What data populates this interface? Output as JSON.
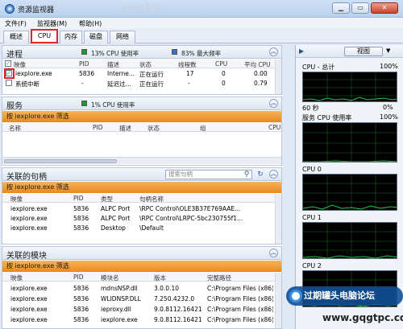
{
  "window": {
    "title": "资源监视器",
    "watermark_brand": "yesky"
  },
  "menu": {
    "file": "文件(F)",
    "monitor": "监视器(M)",
    "help": "帮助(H)"
  },
  "tabs": [
    "概述",
    "CPU",
    "内存",
    "磁盘",
    "网络"
  ],
  "processes": {
    "title": "进程",
    "cpu_usage": "13% CPU 使用率",
    "max_freq": "83% 最大频率",
    "columns": [
      "映像",
      "PID",
      "描述",
      "状态",
      "线程数",
      "CPU",
      "平均 CPU"
    ],
    "rows": [
      {
        "checked": true,
        "image": "iexplore.exe",
        "pid": "5836",
        "desc": "Interne...",
        "status": "正在运行",
        "threads": "17",
        "cpu": "0",
        "avg_cpu": "0.00"
      },
      {
        "checked": false,
        "image": "系统中断",
        "pid": "-",
        "desc": "延迟过...",
        "status": "正在运行",
        "threads": "-",
        "cpu": "0",
        "avg_cpu": "0.79"
      }
    ]
  },
  "services": {
    "title": "服务",
    "cpu_usage": "1% CPU 使用率",
    "filter": "按 iexplore.exe 筛选",
    "columns": [
      "名称",
      "PID",
      "描述",
      "状态",
      "组",
      "CPU"
    ]
  },
  "handles": {
    "title": "关联的句柄",
    "search_placeholder": "搜索句柄",
    "filter": "按 iexplore.exe 筛选",
    "columns": [
      "映像",
      "PID",
      "类型",
      "句柄名称"
    ],
    "rows": [
      {
        "image": "iexplore.exe",
        "pid": "5836",
        "type": "ALPC Port",
        "name": "\\RPC Control\\OLE3B37E769AAE..."
      },
      {
        "image": "iexplore.exe",
        "pid": "5836",
        "type": "ALPC Port",
        "name": "\\RPC Control\\LRPC-5bc230755f1..."
      },
      {
        "image": "iexplore.exe",
        "pid": "5836",
        "type": "Desktop",
        "name": "\\Default"
      }
    ]
  },
  "modules": {
    "title": "关联的模块",
    "filter": "按 iexplore.exe 筛选",
    "columns": [
      "映像",
      "PID",
      "模块名",
      "版本",
      "完整路径"
    ],
    "rows": [
      {
        "image": "iexplore.exe",
        "pid": "5836",
        "module": "mdnsNSP.dll",
        "version": "3.0.0.10",
        "path": "C:\\Program Files (x86)\\"
      },
      {
        "image": "iexplore.exe",
        "pid": "5836",
        "module": "WLIDNSP.DLL",
        "version": "7.250.4232.0",
        "path": "C:\\Program Files (x86)\\"
      },
      {
        "image": "iexplore.exe",
        "pid": "5836",
        "module": "ieproxy.dll",
        "version": "9.0.8112.16421",
        "path": "C:\\Program Files (x86)\\"
      },
      {
        "image": "iexplore.exe",
        "pid": "5836",
        "module": "iexplore.exe",
        "version": "9.0.8112.16421",
        "path": "C:\\Program Files (x86)\\"
      }
    ]
  },
  "right_panel": {
    "view_button": "视图",
    "cpu_total": "CPU - 总计",
    "cpu_total_pct": "100%",
    "time_label": "60 秒",
    "time_pct": "0%",
    "service_cpu": "服务 CPU 使用率",
    "service_cpu_pct": "100%",
    "cores": [
      "CPU 0",
      "CPU 1",
      "CPU 2"
    ]
  },
  "watermark": {
    "site_name": "过期罐头电脑论坛",
    "url": "www.gqgtpc.com"
  },
  "colors": {
    "filter_orange": "#f0a040",
    "highlight_red": "#e0262c",
    "graph_green": "#22c84a",
    "cpu_green": "#1a9a30",
    "freq_blue": "#3a6fc8"
  }
}
